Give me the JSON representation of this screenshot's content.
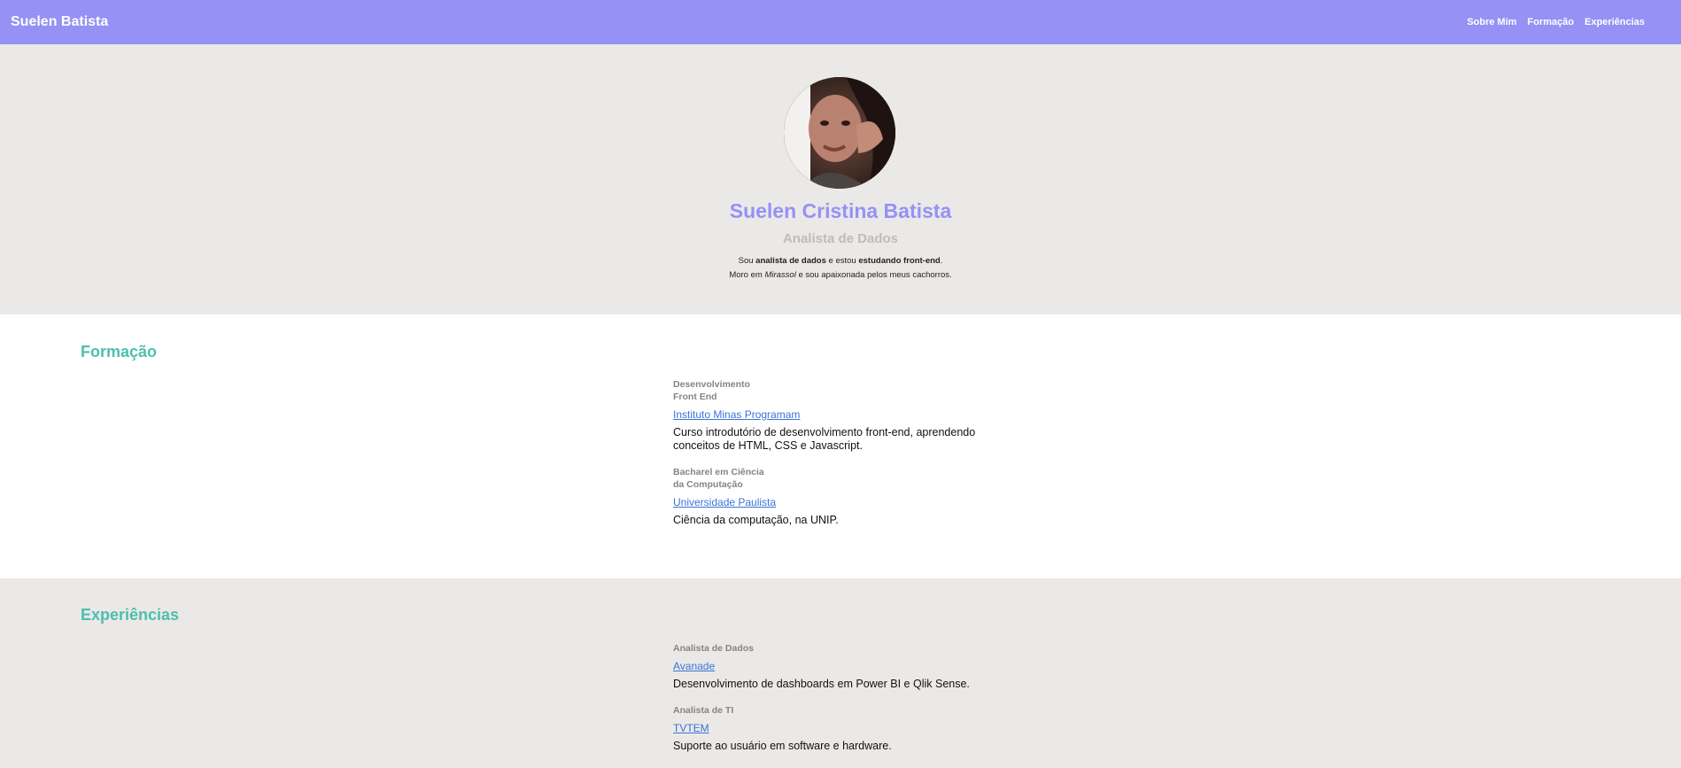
{
  "nav": {
    "brand": "Suelen Batista",
    "links": [
      "Sobre Mim",
      "Formação",
      "Experiências"
    ]
  },
  "hero": {
    "name": "Suelen Cristina Batista",
    "role": "Analista de Dados",
    "bio_line1": {
      "p1": "Sou ",
      "b1": "analista de dados",
      "p2": " e estou ",
      "b2": "estudando front-end",
      "p3": "."
    },
    "bio_line2": {
      "p1": "Moro em ",
      "i1": "Mirassol",
      "p2": " e sou apaixonada pelos meus cachorros."
    }
  },
  "formacao": {
    "title": "Formação",
    "entries": [
      {
        "title_line1": "Desenvolvimento",
        "title_line2": "Front End",
        "link": "Instituto Minas Programam",
        "desc": "Curso introdutório de desenvolvimento front-end, aprendendo conceitos de HTML, CSS e Javascript."
      },
      {
        "title_line1": "Bacharel em Ciência",
        "title_line2": "da Computação",
        "link": "Universidade Paulista",
        "desc": "Ciência da computação, na UNIP."
      }
    ]
  },
  "experiencias": {
    "title": "Experiências",
    "entries": [
      {
        "title": "Analista de Dados",
        "link": "Avanade",
        "desc": "Desenvolvimento de dashboards em Power BI e Qlik Sense."
      },
      {
        "title": "Analista de TI",
        "link": "TVTEM",
        "desc": "Suporte ao usuário em software e hardware."
      }
    ]
  }
}
